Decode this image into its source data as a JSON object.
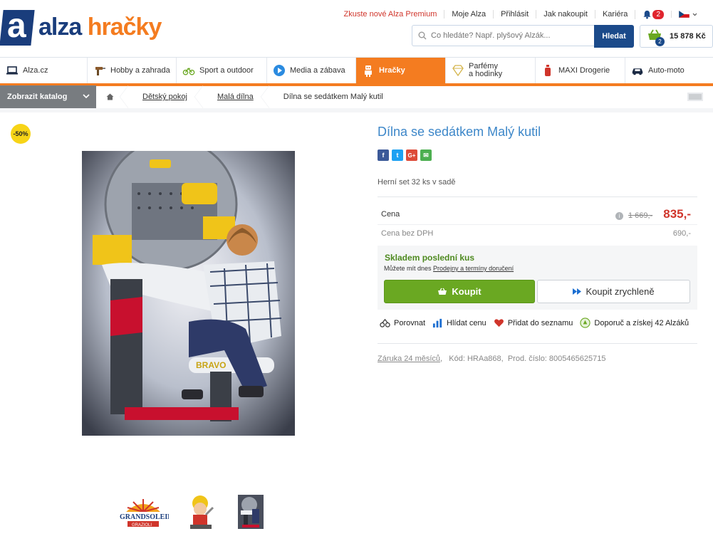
{
  "brand": {
    "part1": "alza",
    "part2": "hračky",
    "mark": "a"
  },
  "toplinks": [
    "Zkuste nové Alza Premium",
    "Moje Alza",
    "Přihlásit",
    "Jak nakoupit",
    "Kariéra"
  ],
  "notifications": {
    "count": "2"
  },
  "language": {
    "country": "CZ"
  },
  "search": {
    "placeholder": "Co hledáte? Např. plyšový Alzák...",
    "button": "Hledat"
  },
  "cart": {
    "count": "2",
    "total": "15 878 Kč"
  },
  "categories": [
    {
      "label": "Alza.cz",
      "icon": "laptop-icon",
      "active": false
    },
    {
      "label": "Hobby a zahrada",
      "icon": "drill-icon",
      "active": false
    },
    {
      "label": "Sport a outdoor",
      "icon": "bicycle-icon",
      "active": false
    },
    {
      "label": "Media a zábava",
      "icon": "play-icon",
      "active": false
    },
    {
      "label": "Hračky",
      "icon": "robot-icon",
      "active": true
    },
    {
      "label": "Parfémy\na hodinky",
      "icon": "diamond-icon",
      "active": false
    },
    {
      "label": "MAXI Drogerie",
      "icon": "bottle-icon",
      "active": false
    },
    {
      "label": "Auto-moto",
      "icon": "car-icon",
      "active": false
    }
  ],
  "catalog": {
    "button": "Zobrazit katalog"
  },
  "breadcrumb": [
    "Dětský pokoj",
    "Malá dílna",
    "Dílna se sedátkem Malý kutil"
  ],
  "product": {
    "discount": "-50%",
    "title": "Dílna se sedátkem Malý kutil",
    "subtitle": "Herní set 32 ks v sadě",
    "social": [
      {
        "label": "f",
        "icon": "facebook-icon",
        "color": "#3b5998"
      },
      {
        "label": "t",
        "icon": "twitter-icon",
        "color": "#1da1f2"
      },
      {
        "label": "G+",
        "icon": "googleplus-icon",
        "color": "#dd4b39"
      },
      {
        "label": "✉",
        "icon": "email-icon",
        "color": "#4caf50"
      }
    ],
    "price_label": "Cena",
    "old_price": "1 669,-",
    "price": "835,-",
    "price_novat_label": "Cena bez DPH",
    "price_novat": "690,-",
    "stock_title": "Skladem poslední kus",
    "stock_text": "Můžete mít dnes",
    "stock_link": "Prodejny a termíny doručení",
    "buy_button": "Koupit",
    "quick_button": "Koupit zrychleně",
    "actions": [
      "Porovnat",
      "Hlídat cenu",
      "Přidat do seznamu",
      "Doporuč a získej 42 Alzáků"
    ],
    "warranty": "Záruka 24 měsíců",
    "code": "Kód: HRAa868,",
    "prod_number": "Prod. číslo: 8005465625715",
    "brand_logo": "GRANDSOLEIL",
    "brand_logo_sub": "GRAZIOLI"
  },
  "colors": {
    "accent": "#f47c20",
    "brand_blue": "#1a3d7c",
    "title_blue": "#3d87c9",
    "price_red": "#d0352b",
    "buy_green": "#6aa822"
  }
}
